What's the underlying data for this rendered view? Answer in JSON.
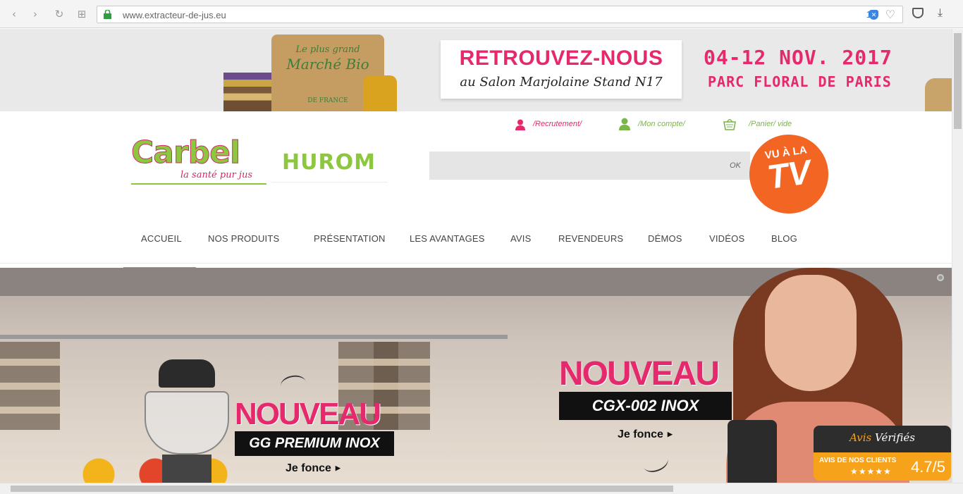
{
  "browser": {
    "url": "www.extracteur-de-jus.eu",
    "badge_count": "1"
  },
  "banner": {
    "bag_small": "Le plus grand",
    "bag_big": "Marché Bio",
    "bag_sub": "DE FRANCE",
    "board_line1": "RETROUVEZ-NOUS",
    "board_line2": "au Salon Marjolaine Stand N17",
    "date": "04-12 NOV. 2017",
    "place": "PARC FLORAL DE PARIS"
  },
  "header": {
    "brand": "Carbel",
    "tagline": "la santé pur jus",
    "partner": "HUROM",
    "links": {
      "recruitment": "/Recrutement/",
      "account": "/Mon compte/",
      "cart": "/Panier/ vide"
    },
    "search": {
      "placeholder": "",
      "button": "OK"
    },
    "tv_badge": {
      "line1": "VU À LA",
      "line2": "TV"
    }
  },
  "menu": {
    "items": [
      "ACCUEIL",
      "NOS PRODUITS",
      "PRÉSENTATION",
      "LES AVANTAGES",
      "AVIS",
      "REVENDEURS",
      "DÉMOS",
      "VIDÉOS",
      "BLOG"
    ]
  },
  "hero": {
    "promo_left": {
      "title": "NOUVEAU",
      "product": "GG PREMIUM INOX",
      "cta": "Je fonce"
    },
    "promo_right": {
      "title": "NOUVEAU",
      "product": "CGX-002 INOX",
      "cta": "Je fonce"
    }
  },
  "reviews": {
    "title_a": "Avis",
    "title_b": "Vérifiés",
    "label": "AVIS DE NOS CLIENTS",
    "stars": "★★★★★",
    "score": "4.7/5"
  },
  "colors": {
    "brand_pink": "#e6286d",
    "brand_green": "#7ab648",
    "tv_orange": "#f26522",
    "reviews_orange": "#f7a21b"
  }
}
